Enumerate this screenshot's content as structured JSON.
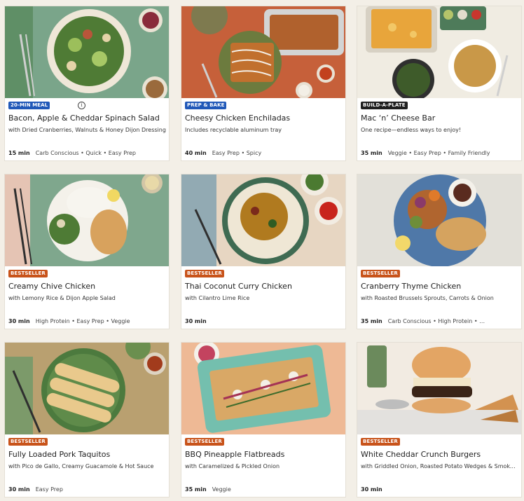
{
  "colors": {
    "badge_blue": "#2058b8",
    "badge_dark": "#1f1f1f",
    "badge_orange": "#c8531a",
    "background": "#f3efe7"
  },
  "recipes": [
    {
      "badge": "20-MIN MEAL",
      "info_icon": "info-icon",
      "title": "Bacon, Apple & Cheddar Spinach Salad",
      "subtitle": "with Dried Cranberries, Walnuts & Honey Dijon Dressing",
      "time": "15 min",
      "tags": "Carb Conscious • Quick • Easy Prep"
    },
    {
      "badge": "PREP & BAKE",
      "title": "Cheesy Chicken Enchiladas",
      "subtitle": "Includes recyclable aluminum tray",
      "time": "40 min",
      "tags": "Easy Prep • Spicy"
    },
    {
      "badge": "BUILD-A-PLATE",
      "title": "Mac ‘n’ Cheese Bar",
      "subtitle": "One recipe—endless ways to enjoy!",
      "time": "35 min",
      "tags": "Veggie • Easy Prep • Family Friendly"
    },
    {
      "badge": "BESTSELLER",
      "title": "Creamy Chive Chicken",
      "subtitle": "with Lemony Rice & Dijon Apple Salad",
      "time": "30 min",
      "tags": "High Protein • Easy Prep • Veggie"
    },
    {
      "badge": "BESTSELLER",
      "title": "Thai Coconut Curry Chicken",
      "subtitle": "with Cilantro Lime Rice",
      "time": "30 min",
      "tags": ""
    },
    {
      "badge": "BESTSELLER",
      "title": "Cranberry Thyme Chicken",
      "subtitle": "with Roasted Brussels Sprouts, Carrots & Onion",
      "time": "35 min",
      "tags": "Carb Conscious • High Protein • …"
    },
    {
      "badge": "BESTSELLER",
      "title": "Fully Loaded Pork Taquitos",
      "subtitle": "with Pico de Gallo, Creamy Guacamole & Hot Sauce",
      "time": "30 min",
      "tags": "Easy Prep"
    },
    {
      "badge": "BESTSELLER",
      "title": "BBQ Pineapple Flatbreads",
      "subtitle": "with Caramelized & Pickled Onion",
      "time": "35 min",
      "tags": "Veggie"
    },
    {
      "badge": "BESTSELLER",
      "title": "White Cheddar Crunch Burgers",
      "subtitle": "with Griddled Onion, Roasted Potato Wedges & Smoky Mayo",
      "time": "30 min",
      "tags": ""
    }
  ]
}
